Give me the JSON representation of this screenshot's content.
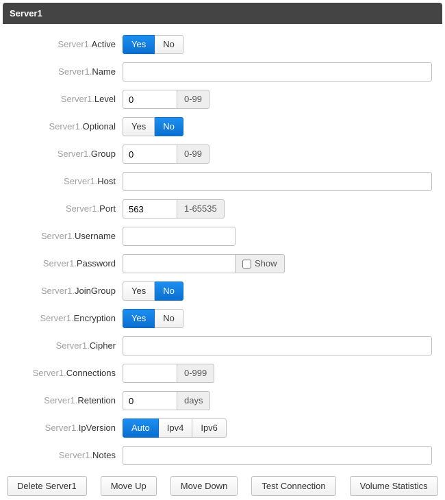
{
  "header": {
    "title": "Server1"
  },
  "prefix": "Server1.",
  "rows": {
    "active": {
      "label": "Active",
      "type": "toggle-yn",
      "value": "yes"
    },
    "name": {
      "label": "Name",
      "type": "text-full",
      "value": ""
    },
    "level": {
      "label": "Level",
      "type": "num-addon",
      "value": "0",
      "addon": "0-99"
    },
    "optional": {
      "label": "Optional",
      "type": "toggle-yn",
      "value": "no"
    },
    "group": {
      "label": "Group",
      "type": "num-addon",
      "value": "0",
      "addon": "0-99"
    },
    "host": {
      "label": "Host",
      "type": "text-full",
      "value": ""
    },
    "port": {
      "label": "Port",
      "type": "num-addon",
      "value": "563",
      "addon": "1-65535"
    },
    "username": {
      "label": "Username",
      "type": "text-med",
      "value": ""
    },
    "password": {
      "label": "Password",
      "type": "password",
      "value": "",
      "show_label": "Show"
    },
    "joingroup": {
      "label": "JoinGroup",
      "type": "toggle-yn",
      "value": "no"
    },
    "encryption": {
      "label": "Encryption",
      "type": "toggle-yn",
      "value": "yes"
    },
    "cipher": {
      "label": "Cipher",
      "type": "text-full",
      "value": ""
    },
    "connections": {
      "label": "Connections",
      "type": "num-addon",
      "value": "",
      "addon": "0-999"
    },
    "retention": {
      "label": "Retention",
      "type": "num-addon",
      "value": "0",
      "addon": "days"
    },
    "ipversion": {
      "label": "IpVersion",
      "type": "toggle-ip",
      "value": "auto"
    },
    "notes": {
      "label": "Notes",
      "type": "text-full",
      "value": ""
    }
  },
  "toggle_labels": {
    "yes": "Yes",
    "no": "No",
    "auto": "Auto",
    "ipv4": "Ipv4",
    "ipv6": "Ipv6"
  },
  "footer_buttons": {
    "delete": "Delete Server1",
    "moveup": "Move Up",
    "movedown": "Move Down",
    "test": "Test Connection",
    "volume": "Volume Statistics"
  }
}
